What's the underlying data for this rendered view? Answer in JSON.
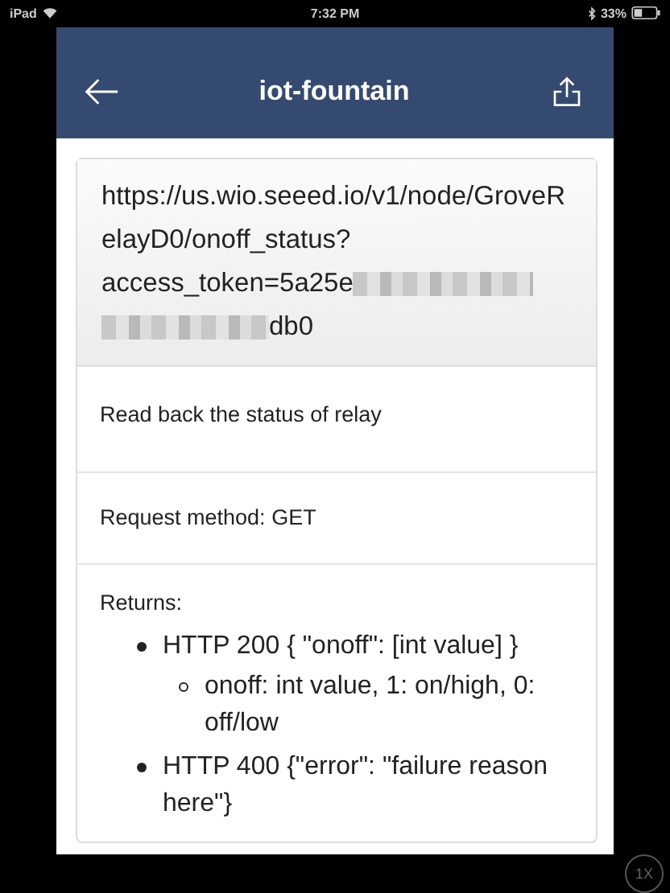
{
  "status_bar": {
    "device": "iPad",
    "time": "7:32 PM",
    "battery": "33%"
  },
  "header": {
    "title": "iot-fountain"
  },
  "endpoint": {
    "url": "https://us.wio.seeed.io/v1/node/GroveRelayD0/onoff_status?",
    "token_start": "access_token=5a25e",
    "token_end": "db0"
  },
  "description": "Read back the status of relay",
  "request_method": "Request method: GET",
  "returns": {
    "label": "Returns:",
    "items": [
      {
        "text": "HTTP 200 { \"onoff\": [int value] }",
        "children": [
          {
            "text": "onoff: int value, 1: on/high, 0: off/low"
          }
        ]
      },
      {
        "text": "HTTP 400 {\"error\": \"failure reason here\"}"
      }
    ]
  },
  "zoom_badge": "1X"
}
